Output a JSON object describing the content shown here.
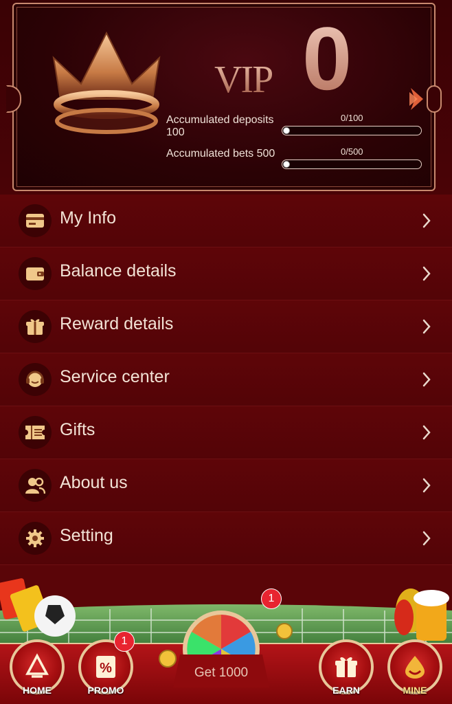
{
  "vip": {
    "label": "VIP",
    "level": "0",
    "deposits_label": "Accumulated deposits 100",
    "deposits_progress": "0/100",
    "deposits_fraction": 0,
    "bets_label": "Accumulated bets 500",
    "bets_progress": "0/500",
    "bets_fraction": 0
  },
  "menu": {
    "items": [
      {
        "label": "My Info",
        "icon": "id-card-icon"
      },
      {
        "label": "Balance details",
        "icon": "wallet-icon"
      },
      {
        "label": "Reward details",
        "icon": "gift-icon"
      },
      {
        "label": "Service center",
        "icon": "headset-icon"
      },
      {
        "label": "Gifts",
        "icon": "ticket-icon"
      },
      {
        "label": "About us",
        "icon": "users-icon"
      },
      {
        "label": "Setting",
        "icon": "gear-icon"
      }
    ]
  },
  "bottom_nav": {
    "home": "HOME",
    "promo": "PROMO",
    "promo_badge": "1",
    "wheel_label": "Get 1000",
    "wheel_badge": "1",
    "earn": "EARN",
    "mine": "MINE"
  },
  "colors": {
    "background": "#5a0508",
    "text": "#f3e3d6",
    "accent_gold": "#e8c79a",
    "badge_red": "#e82430"
  }
}
